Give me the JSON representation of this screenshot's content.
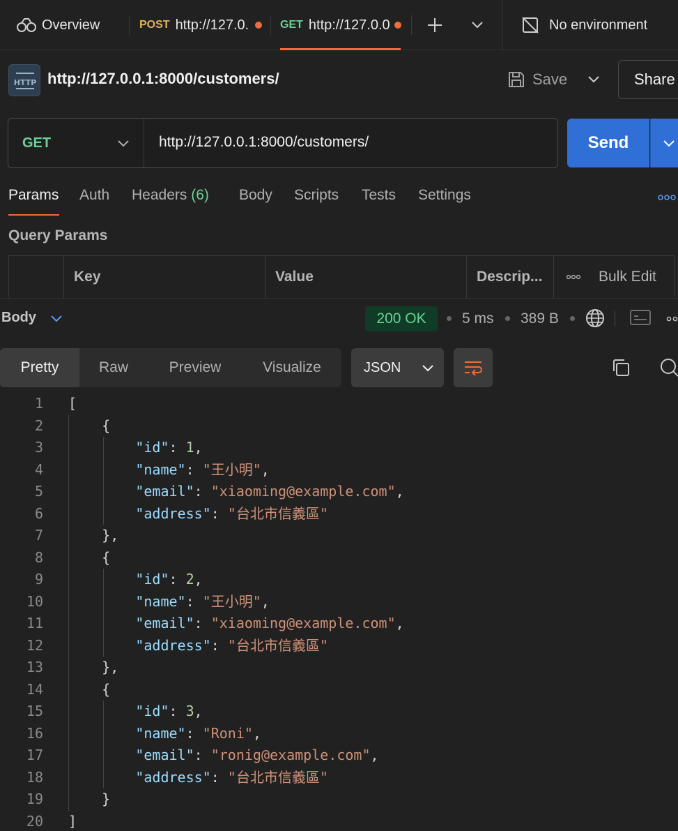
{
  "tabs": {
    "overview": "Overview",
    "tab1": {
      "method": "POST",
      "url": "http://127.0."
    },
    "tab2": {
      "method": "GET",
      "url": "http://127.0.0"
    },
    "environment": "No environment"
  },
  "request": {
    "title": "http://127.0.0.1:8000/customers/",
    "save_label": "Save",
    "share_label": "Share",
    "method": "GET",
    "url": "http://127.0.0.1:8000/customers/",
    "send_label": "Send"
  },
  "request_tabs": {
    "params": "Params",
    "auth": "Auth",
    "headers": "Headers",
    "headers_count": "(6)",
    "body": "Body",
    "scripts": "Scripts",
    "tests": "Tests",
    "settings": "Settings"
  },
  "query_params": {
    "title": "Query Params",
    "col_key": "Key",
    "col_value": "Value",
    "col_desc": "Descrip...",
    "bulk_edit": "Bulk Edit"
  },
  "response": {
    "body_label": "Body",
    "status": "200 OK",
    "time": "5 ms",
    "size": "389 B",
    "views": {
      "pretty": "Pretty",
      "raw": "Raw",
      "preview": "Preview",
      "visualize": "Visualize"
    },
    "format": "JSON"
  },
  "code_lines": [
    {
      "n": "1",
      "parts": [
        [
          "p",
          "["
        ]
      ]
    },
    {
      "n": "2",
      "parts": [
        [
          "p",
          "    {"
        ]
      ]
    },
    {
      "n": "3",
      "parts": [
        [
          "p",
          "        "
        ],
        [
          "k",
          "\"id\""
        ],
        [
          "p",
          ": "
        ],
        [
          "n",
          "1"
        ],
        [
          "p",
          ","
        ]
      ]
    },
    {
      "n": "4",
      "parts": [
        [
          "p",
          "        "
        ],
        [
          "k",
          "\"name\""
        ],
        [
          "p",
          ": "
        ],
        [
          "s",
          "\"王小明\""
        ],
        [
          "p",
          ","
        ]
      ]
    },
    {
      "n": "5",
      "parts": [
        [
          "p",
          "        "
        ],
        [
          "k",
          "\"email\""
        ],
        [
          "p",
          ": "
        ],
        [
          "s",
          "\"xiaoming@example.com\""
        ],
        [
          "p",
          ","
        ]
      ]
    },
    {
      "n": "6",
      "parts": [
        [
          "p",
          "        "
        ],
        [
          "k",
          "\"address\""
        ],
        [
          "p",
          ": "
        ],
        [
          "s",
          "\"台北市信義區\""
        ]
      ]
    },
    {
      "n": "7",
      "parts": [
        [
          "p",
          "    },"
        ]
      ]
    },
    {
      "n": "8",
      "parts": [
        [
          "p",
          "    {"
        ]
      ]
    },
    {
      "n": "9",
      "parts": [
        [
          "p",
          "        "
        ],
        [
          "k",
          "\"id\""
        ],
        [
          "p",
          ": "
        ],
        [
          "n",
          "2"
        ],
        [
          "p",
          ","
        ]
      ]
    },
    {
      "n": "10",
      "parts": [
        [
          "p",
          "        "
        ],
        [
          "k",
          "\"name\""
        ],
        [
          "p",
          ": "
        ],
        [
          "s",
          "\"王小明\""
        ],
        [
          "p",
          ","
        ]
      ]
    },
    {
      "n": "11",
      "parts": [
        [
          "p",
          "        "
        ],
        [
          "k",
          "\"email\""
        ],
        [
          "p",
          ": "
        ],
        [
          "s",
          "\"xiaoming@example.com\""
        ],
        [
          "p",
          ","
        ]
      ]
    },
    {
      "n": "12",
      "parts": [
        [
          "p",
          "        "
        ],
        [
          "k",
          "\"address\""
        ],
        [
          "p",
          ": "
        ],
        [
          "s",
          "\"台北市信義區\""
        ]
      ]
    },
    {
      "n": "13",
      "parts": [
        [
          "p",
          "    },"
        ]
      ]
    },
    {
      "n": "14",
      "parts": [
        [
          "p",
          "    {"
        ]
      ]
    },
    {
      "n": "15",
      "parts": [
        [
          "p",
          "        "
        ],
        [
          "k",
          "\"id\""
        ],
        [
          "p",
          ": "
        ],
        [
          "n",
          "3"
        ],
        [
          "p",
          ","
        ]
      ]
    },
    {
      "n": "16",
      "parts": [
        [
          "p",
          "        "
        ],
        [
          "k",
          "\"name\""
        ],
        [
          "p",
          ": "
        ],
        [
          "s",
          "\"Roni\""
        ],
        [
          "p",
          ","
        ]
      ]
    },
    {
      "n": "17",
      "parts": [
        [
          "p",
          "        "
        ],
        [
          "k",
          "\"email\""
        ],
        [
          "p",
          ": "
        ],
        [
          "s",
          "\"ronig@example.com\""
        ],
        [
          "p",
          ","
        ]
      ]
    },
    {
      "n": "18",
      "parts": [
        [
          "p",
          "        "
        ],
        [
          "k",
          "\"address\""
        ],
        [
          "p",
          ": "
        ],
        [
          "s",
          "\"台北市信義區\""
        ]
      ]
    },
    {
      "n": "19",
      "parts": [
        [
          "p",
          "    }"
        ]
      ]
    },
    {
      "n": "20",
      "parts": [
        [
          "p",
          "]"
        ]
      ]
    }
  ]
}
